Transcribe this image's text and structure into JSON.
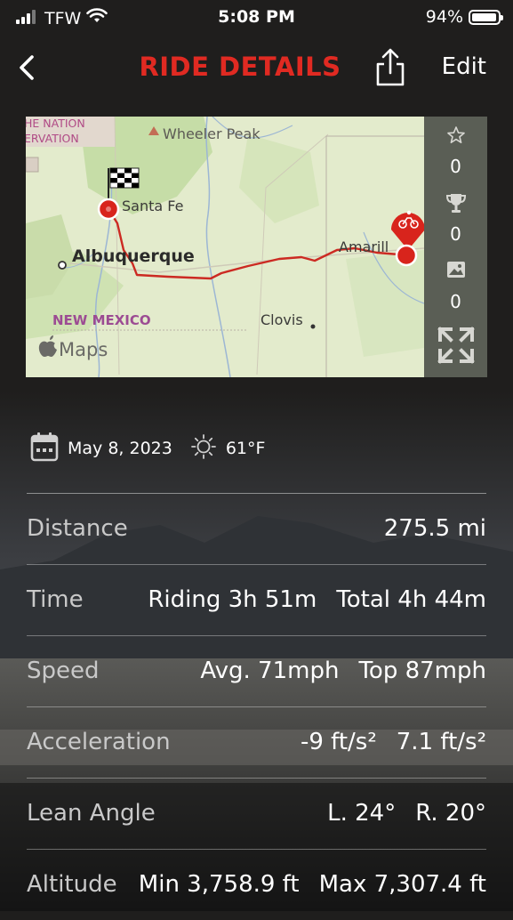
{
  "status_bar": {
    "carrier": "TFW",
    "time": "5:08 PM",
    "battery": "94%"
  },
  "nav": {
    "title": "RIDE DETAILS",
    "edit_label": "Edit"
  },
  "map": {
    "labels": {
      "nation_line1": "HE NATION",
      "nation_line2": "ERVATION",
      "wheeler_peak": "Wheeler Peak",
      "santa_fe": "Santa Fe",
      "albuquerque": "Albuquerque",
      "amarillo": "Amarill",
      "new_mexico": "NEW MEXICO",
      "clovis": "Clovis",
      "maps_brand": "Maps"
    },
    "colors": {
      "route": "#cc2a22",
      "land": "#dfe9c6",
      "marker": "#d8241c"
    }
  },
  "side_panel": {
    "favorites_count": "0",
    "trophies_count": "0",
    "photos_count": "0"
  },
  "ride": {
    "date": "May 8, 2023",
    "temperature": "61°F"
  },
  "stats": [
    {
      "label": "Distance",
      "values": [
        "275.5 mi"
      ]
    },
    {
      "label": "Time",
      "values": [
        "Riding 3h 51m",
        "Total 4h 44m"
      ]
    },
    {
      "label": "Speed",
      "values": [
        "Avg. 71mph",
        "Top 87mph"
      ]
    },
    {
      "label": "Acceleration",
      "values": [
        "-9 ft/s²",
        "7.1 ft/s²"
      ]
    },
    {
      "label": "Lean Angle",
      "values": [
        "L. 24°",
        "R. 20°"
      ]
    },
    {
      "label": "Altitude",
      "values": [
        "Min 3,758.9 ft",
        "Max 7,307.4 ft"
      ]
    }
  ]
}
